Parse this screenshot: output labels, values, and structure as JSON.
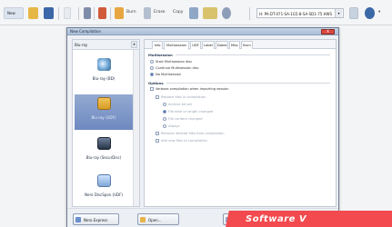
{
  "toolbar": {
    "new_label": "New",
    "erase_label": "Erase",
    "copy_label": "Copy",
    "burn_label": "Burn",
    "drive_value": "H: PA-DT-071-SA-1G5-8-SA-SD1-75 HWS"
  },
  "dialog": {
    "title": "New Compilation",
    "close_label": "X",
    "sidebar": {
      "selector_value": "Blu-ray",
      "items": [
        {
          "label": "Blu-ray (BD)",
          "icon": "blu-ray-disc-icon"
        },
        {
          "label": "Blu-ray (UDF)",
          "icon": "blu-ray-udf-icon"
        },
        {
          "label": "Blu-ray (SecurDisc)",
          "icon": "securdisc-icon"
        },
        {
          "label": "Nero DiscSpan (UDF)",
          "icon": "discspan-icon"
        }
      ]
    },
    "tabs": [
      "Info",
      "Multisession",
      "UDF",
      "Label",
      "Dates",
      "Misc",
      "Burn"
    ],
    "multisession": {
      "heading": "Multisession",
      "options": [
        "Start Multisession disc",
        "Continue Multisession disc",
        "No Multisession"
      ]
    },
    "options_section": {
      "heading": "Options",
      "checks": [
        {
          "label": "Verbose compilation when importing session",
          "indent": 0
        },
        {
          "label": "Replace files in compilation",
          "indent": 1
        },
        {
          "label": "Remove deleted files from compilation",
          "indent": 1
        },
        {
          "label": "Add new files to compilation",
          "indent": 1
        }
      ],
      "radios": [
        "Archive bit set",
        "File date or length changed",
        "File content changed",
        "Always"
      ]
    },
    "buttons": {
      "nero_express": "Nero Express",
      "open": "Open..."
    }
  },
  "banner": {
    "text": "Software V"
  },
  "colors": {
    "accent": "#3f77c3",
    "banner": "#f24a4e",
    "selection": "#7b95c7"
  }
}
